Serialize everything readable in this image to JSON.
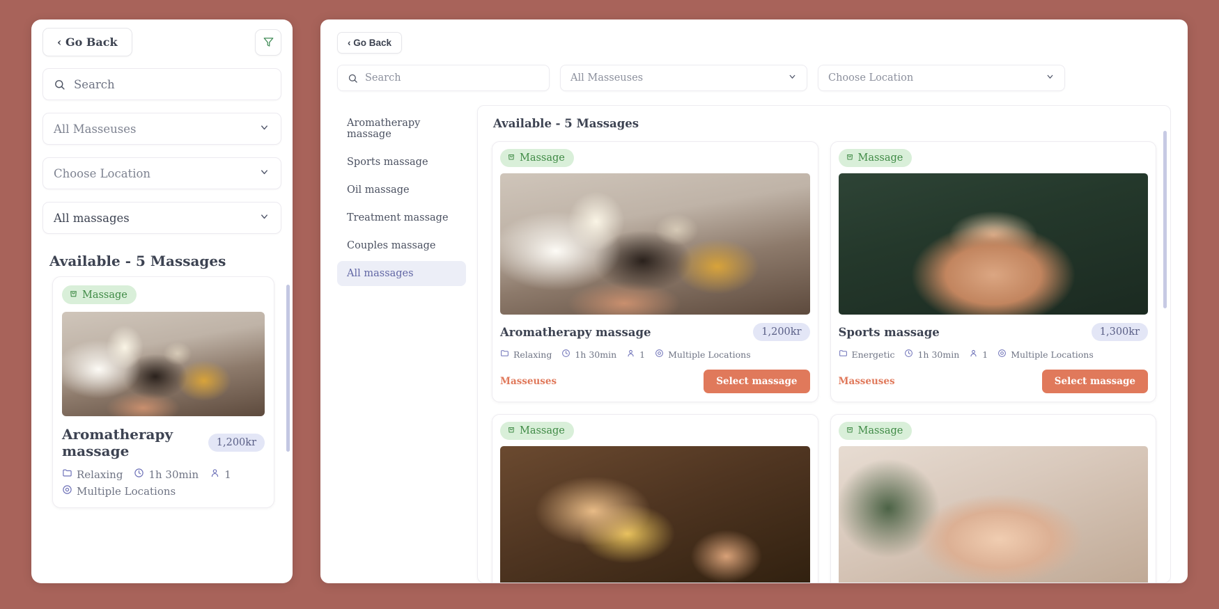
{
  "theme": {
    "page_background": "#a8635a",
    "accent": "#e0795b",
    "badge_green_bg": "#d9efd9",
    "badge_green_text": "#3f8a45",
    "price_pill_bg": "#e3e6f6",
    "price_pill_text": "#5a5f86",
    "icon_indigo": "#6e72b8",
    "active_nav_bg": "#eceef7",
    "active_nav_text": "#6166a4"
  },
  "mobile_panel": {
    "go_back_label": "‹ Go Back",
    "filter_icon": "filter-funnel-icon",
    "search": {
      "placeholder": "Search",
      "icon": "search-icon",
      "value": ""
    },
    "selects": [
      {
        "label": "All Masseuses",
        "icon": "chevron-down-icon",
        "muted": true
      },
      {
        "label": "Choose Location",
        "icon": "chevron-down-icon",
        "muted": true
      },
      {
        "label": "All massages",
        "icon": "chevron-down-icon",
        "muted": false
      }
    ],
    "results_heading": "Available - 5 Massages",
    "card": {
      "badge": "Massage",
      "badge_icon": "shopping-bag-icon",
      "title": "Aromatherapy massage",
      "price": "1,200kr",
      "meta": [
        {
          "icon": "folder-icon",
          "text": "Relaxing"
        },
        {
          "icon": "clock-icon",
          "text": "1h 30min"
        },
        {
          "icon": "person-icon",
          "text": "1"
        },
        {
          "icon": "location-pin-icon",
          "text": "Multiple Locations"
        }
      ]
    }
  },
  "desktop_panel": {
    "go_back_label": "‹ Go Back",
    "search": {
      "placeholder": "Search",
      "icon": "search-icon",
      "value": ""
    },
    "selects": [
      {
        "label": "All Masseuses",
        "icon": "chevron-down-icon"
      },
      {
        "label": "Choose Location",
        "icon": "chevron-down-icon"
      }
    ],
    "categories": [
      {
        "label": "Aromatherapy massage",
        "active": false
      },
      {
        "label": "Sports massage",
        "active": false
      },
      {
        "label": "Oil massage",
        "active": false
      },
      {
        "label": "Treatment massage",
        "active": false
      },
      {
        "label": "Couples massage",
        "active": false
      },
      {
        "label": "All massages",
        "active": true
      }
    ],
    "results_heading": "Available - 5 Massages",
    "cards": [
      {
        "badge": "Massage",
        "badge_icon": "shopping-bag-icon",
        "title": "Aromatherapy massage",
        "price": "1,200kr",
        "photo": "ph-aroma",
        "meta": [
          {
            "icon": "folder-icon",
            "text": "Relaxing"
          },
          {
            "icon": "clock-icon",
            "text": "1h 30min"
          },
          {
            "icon": "person-icon",
            "text": "1"
          },
          {
            "icon": "location-pin-icon",
            "text": "Multiple Locations"
          }
        ],
        "masseuses_label": "Masseuses",
        "select_label": "Select massage"
      },
      {
        "badge": "Massage",
        "badge_icon": "shopping-bag-icon",
        "title": "Sports massage",
        "price": "1,300kr",
        "photo": "ph-sports",
        "meta": [
          {
            "icon": "folder-icon",
            "text": "Energetic"
          },
          {
            "icon": "clock-icon",
            "text": "1h 30min"
          },
          {
            "icon": "person-icon",
            "text": "1"
          },
          {
            "icon": "location-pin-icon",
            "text": "Multiple Locations"
          }
        ],
        "masseuses_label": "Masseuses",
        "select_label": "Select massage"
      },
      {
        "badge": "Massage",
        "badge_icon": "shopping-bag-icon",
        "title": "",
        "price": "",
        "photo": "ph-oil",
        "meta": [],
        "masseuses_label": "",
        "select_label": ""
      },
      {
        "badge": "Massage",
        "badge_icon": "shopping-bag-icon",
        "title": "",
        "price": "",
        "photo": "ph-treatment",
        "meta": [],
        "masseuses_label": "",
        "select_label": ""
      }
    ]
  }
}
